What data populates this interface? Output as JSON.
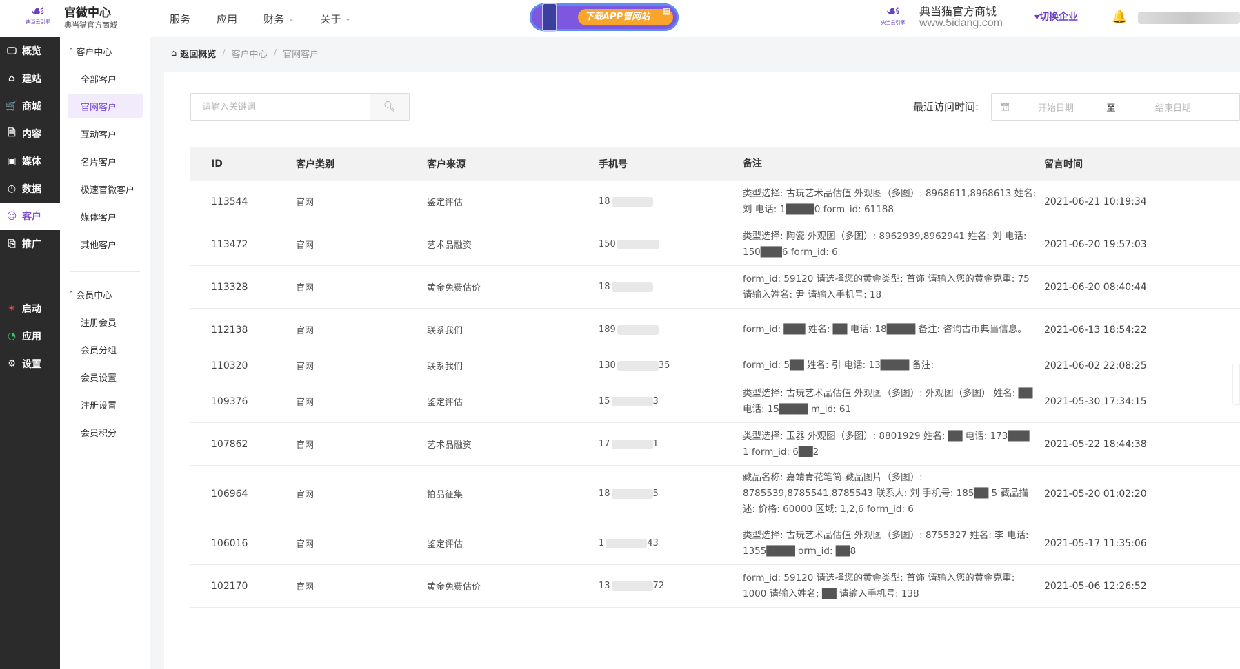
{
  "header": {
    "brand_title": "官微中心",
    "brand_sub": "典当猫官方商城",
    "logo_mini_text": "典当云引擎",
    "nav": [
      {
        "label": "服务",
        "has_dropdown": false
      },
      {
        "label": "应用",
        "has_dropdown": false
      },
      {
        "label": "财务",
        "has_dropdown": true
      },
      {
        "label": "关于",
        "has_dropdown": true
      }
    ],
    "banner_text": "下载APP管网站",
    "store_name": "典当猫官方商城",
    "store_url": "www.5idang.com",
    "switch_label": "▾切换企业"
  },
  "sidebar": {
    "items": [
      {
        "label": "概览",
        "icon": "monitor-icon",
        "active": false
      },
      {
        "label": "建站",
        "icon": "home-icon",
        "active": false
      },
      {
        "label": "商城",
        "icon": "cart-icon",
        "active": false
      },
      {
        "label": "内容",
        "icon": "document-icon",
        "active": false
      },
      {
        "label": "媒体",
        "icon": "media-icon",
        "active": false
      },
      {
        "label": "数据",
        "icon": "clock-icon",
        "active": false
      },
      {
        "label": "客户",
        "icon": "user-icon",
        "active": true
      },
      {
        "label": "推广",
        "icon": "tag-icon",
        "active": false
      }
    ],
    "bottom_items": [
      {
        "label": "启动",
        "icon": "launch-icon"
      },
      {
        "label": "应用",
        "icon": "apps-icon"
      },
      {
        "label": "设置",
        "icon": "gear-icon"
      }
    ]
  },
  "submenu": {
    "group1": "客户中心",
    "group1_items": [
      "全部客户",
      "官网客户",
      "互动客户",
      "名片客户",
      "极速官微客户",
      "媒体客户",
      "其他客户"
    ],
    "group2": "会员中心",
    "group2_items": [
      "注册会员",
      "会员分组",
      "会员设置",
      "注册设置",
      "会员积分"
    ]
  },
  "breadcrumb": {
    "back": "返回概览",
    "level1": "客户中心",
    "level2": "官网客户"
  },
  "filters": {
    "search_placeholder": "请输入关键词",
    "date_label": "最近访问时间:",
    "start_placeholder": "开始日期",
    "to": "至",
    "end_placeholder": "结束日期"
  },
  "table": {
    "headers": [
      "ID",
      "客户类别",
      "客户来源",
      "手机号",
      "备注",
      "留言时间"
    ],
    "rows": [
      {
        "id": "113544",
        "type": "官网",
        "source": "鉴定评估",
        "phone": "18",
        "phone_tail": "",
        "note": "类型选择: 古玩艺术品估值 外观图（多图）: 8968611,8968613 姓名: 刘 电话: 1████0 form_id: 61188",
        "time": "2021-06-21 10:19:34"
      },
      {
        "id": "113472",
        "type": "官网",
        "source": "艺术品融资",
        "phone": "150",
        "phone_tail": "",
        "note": "类型选择: 陶瓷 外观图（多图）: 8962939,8962941 姓名: 刘 电话: 150███6 form_id: 6",
        "time": "2021-06-20 19:57:03"
      },
      {
        "id": "113328",
        "type": "官网",
        "source": "黄金免费估价",
        "phone": "18",
        "phone_tail": "",
        "note": "form_id: 59120 请选择您的黄金类型: 首饰 请输入您的黄金克重: 75 请输入姓名: 尹 请输入手机号: 18",
        "time": "2021-06-20 08:40:44"
      },
      {
        "id": "112138",
        "type": "官网",
        "source": "联系我们",
        "phone": "189",
        "phone_tail": "",
        "note": "form_id: ███ 姓名: ██ 电话: 18████ 备注: 咨询古币典当信息。",
        "time": "2021-06-13 18:54:22"
      },
      {
        "id": "110320",
        "type": "官网",
        "source": "联系我们",
        "phone": "130",
        "phone_tail": "35",
        "note": "form_id: 5██ 姓名: 引 电话: 13████ 备注:",
        "time": "2021-06-02 22:08:25"
      },
      {
        "id": "109376",
        "type": "官网",
        "source": "鉴定评估",
        "phone": "15",
        "phone_tail": "3",
        "note": "类型选择: 古玩艺术品估值 外观图（多图）: 外观图（多图） 姓名: ██ 电话: 15████ m_id: 61",
        "time": "2021-05-30 17:34:15"
      },
      {
        "id": "107862",
        "type": "官网",
        "source": "艺术品融资",
        "phone": "17",
        "phone_tail": "1",
        "note": "类型选择: 玉器 外观图（多图）: 8801929 姓名: ██ 电话: 173███ 1 form_id: 6██2",
        "time": "2021-05-22 18:44:38"
      },
      {
        "id": "106964",
        "type": "官网",
        "source": "拍品征集",
        "phone": "18",
        "phone_tail": "5",
        "note": "藏品名称: 嘉靖青花笔筒 藏品图片（多图）: 8785539,8785541,8785543 联系人: 刘 手机号: 185██ 5 藏品描述: 价格: 60000 区域: 1,2,6 form_id: 6",
        "time": "2021-05-20 01:02:20"
      },
      {
        "id": "106016",
        "type": "官网",
        "source": "鉴定评估",
        "phone": "1",
        "phone_tail": "43",
        "note": "类型选择: 古玩艺术品估值 外观图（多图）: 8755327 姓名: 李 电话: 1355████ orm_id: ██8",
        "time": "2021-05-17 11:35:06"
      },
      {
        "id": "102170",
        "type": "官网",
        "source": "黄金免费估价",
        "phone": "13",
        "phone_tail": "72",
        "note": "form_id: 59120 请选择您的黄金类型: 首饰 请输入您的黄金克重: 1000 请输入姓名: ██ 请输入手机号: 138",
        "time": "2021-05-06 12:26:52"
      }
    ]
  }
}
